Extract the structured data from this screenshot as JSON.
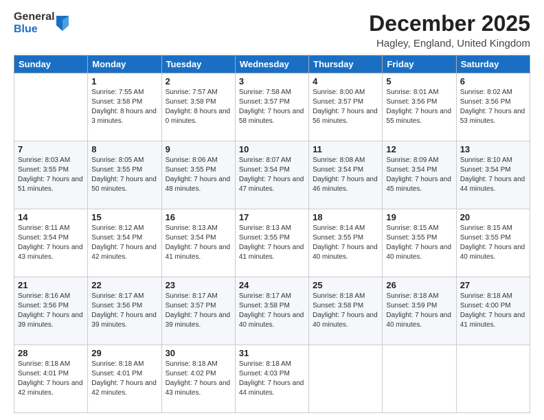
{
  "header": {
    "logo": {
      "general": "General",
      "blue": "Blue"
    },
    "title": "December 2025",
    "subtitle": "Hagley, England, United Kingdom"
  },
  "days_of_week": [
    "Sunday",
    "Monday",
    "Tuesday",
    "Wednesday",
    "Thursday",
    "Friday",
    "Saturday"
  ],
  "weeks": [
    [
      {
        "day": "",
        "sunrise": "",
        "sunset": "",
        "daylight": "",
        "empty": true
      },
      {
        "day": "1",
        "sunrise": "7:55 AM",
        "sunset": "3:58 PM",
        "daylight": "8 hours and 3 minutes.",
        "empty": false
      },
      {
        "day": "2",
        "sunrise": "7:57 AM",
        "sunset": "3:58 PM",
        "daylight": "8 hours and 0 minutes.",
        "empty": false
      },
      {
        "day": "3",
        "sunrise": "7:58 AM",
        "sunset": "3:57 PM",
        "daylight": "7 hours and 58 minutes.",
        "empty": false
      },
      {
        "day": "4",
        "sunrise": "8:00 AM",
        "sunset": "3:57 PM",
        "daylight": "7 hours and 56 minutes.",
        "empty": false
      },
      {
        "day": "5",
        "sunrise": "8:01 AM",
        "sunset": "3:56 PM",
        "daylight": "7 hours and 55 minutes.",
        "empty": false
      },
      {
        "day": "6",
        "sunrise": "8:02 AM",
        "sunset": "3:56 PM",
        "daylight": "7 hours and 53 minutes.",
        "empty": false
      }
    ],
    [
      {
        "day": "7",
        "sunrise": "8:03 AM",
        "sunset": "3:55 PM",
        "daylight": "7 hours and 51 minutes.",
        "empty": false
      },
      {
        "day": "8",
        "sunrise": "8:05 AM",
        "sunset": "3:55 PM",
        "daylight": "7 hours and 50 minutes.",
        "empty": false
      },
      {
        "day": "9",
        "sunrise": "8:06 AM",
        "sunset": "3:55 PM",
        "daylight": "7 hours and 48 minutes.",
        "empty": false
      },
      {
        "day": "10",
        "sunrise": "8:07 AM",
        "sunset": "3:54 PM",
        "daylight": "7 hours and 47 minutes.",
        "empty": false
      },
      {
        "day": "11",
        "sunrise": "8:08 AM",
        "sunset": "3:54 PM",
        "daylight": "7 hours and 46 minutes.",
        "empty": false
      },
      {
        "day": "12",
        "sunrise": "8:09 AM",
        "sunset": "3:54 PM",
        "daylight": "7 hours and 45 minutes.",
        "empty": false
      },
      {
        "day": "13",
        "sunrise": "8:10 AM",
        "sunset": "3:54 PM",
        "daylight": "7 hours and 44 minutes.",
        "empty": false
      }
    ],
    [
      {
        "day": "14",
        "sunrise": "8:11 AM",
        "sunset": "3:54 PM",
        "daylight": "7 hours and 43 minutes.",
        "empty": false
      },
      {
        "day": "15",
        "sunrise": "8:12 AM",
        "sunset": "3:54 PM",
        "daylight": "7 hours and 42 minutes.",
        "empty": false
      },
      {
        "day": "16",
        "sunrise": "8:13 AM",
        "sunset": "3:54 PM",
        "daylight": "7 hours and 41 minutes.",
        "empty": false
      },
      {
        "day": "17",
        "sunrise": "8:13 AM",
        "sunset": "3:55 PM",
        "daylight": "7 hours and 41 minutes.",
        "empty": false
      },
      {
        "day": "18",
        "sunrise": "8:14 AM",
        "sunset": "3:55 PM",
        "daylight": "7 hours and 40 minutes.",
        "empty": false
      },
      {
        "day": "19",
        "sunrise": "8:15 AM",
        "sunset": "3:55 PM",
        "daylight": "7 hours and 40 minutes.",
        "empty": false
      },
      {
        "day": "20",
        "sunrise": "8:15 AM",
        "sunset": "3:55 PM",
        "daylight": "7 hours and 40 minutes.",
        "empty": false
      }
    ],
    [
      {
        "day": "21",
        "sunrise": "8:16 AM",
        "sunset": "3:56 PM",
        "daylight": "7 hours and 39 minutes.",
        "empty": false
      },
      {
        "day": "22",
        "sunrise": "8:17 AM",
        "sunset": "3:56 PM",
        "daylight": "7 hours and 39 minutes.",
        "empty": false
      },
      {
        "day": "23",
        "sunrise": "8:17 AM",
        "sunset": "3:57 PM",
        "daylight": "7 hours and 39 minutes.",
        "empty": false
      },
      {
        "day": "24",
        "sunrise": "8:17 AM",
        "sunset": "3:58 PM",
        "daylight": "7 hours and 40 minutes.",
        "empty": false
      },
      {
        "day": "25",
        "sunrise": "8:18 AM",
        "sunset": "3:58 PM",
        "daylight": "7 hours and 40 minutes.",
        "empty": false
      },
      {
        "day": "26",
        "sunrise": "8:18 AM",
        "sunset": "3:59 PM",
        "daylight": "7 hours and 40 minutes.",
        "empty": false
      },
      {
        "day": "27",
        "sunrise": "8:18 AM",
        "sunset": "4:00 PM",
        "daylight": "7 hours and 41 minutes.",
        "empty": false
      }
    ],
    [
      {
        "day": "28",
        "sunrise": "8:18 AM",
        "sunset": "4:01 PM",
        "daylight": "7 hours and 42 minutes.",
        "empty": false
      },
      {
        "day": "29",
        "sunrise": "8:18 AM",
        "sunset": "4:01 PM",
        "daylight": "7 hours and 42 minutes.",
        "empty": false
      },
      {
        "day": "30",
        "sunrise": "8:18 AM",
        "sunset": "4:02 PM",
        "daylight": "7 hours and 43 minutes.",
        "empty": false
      },
      {
        "day": "31",
        "sunrise": "8:18 AM",
        "sunset": "4:03 PM",
        "daylight": "7 hours and 44 minutes.",
        "empty": false
      },
      {
        "day": "",
        "sunrise": "",
        "sunset": "",
        "daylight": "",
        "empty": true
      },
      {
        "day": "",
        "sunrise": "",
        "sunset": "",
        "daylight": "",
        "empty": true
      },
      {
        "day": "",
        "sunrise": "",
        "sunset": "",
        "daylight": "",
        "empty": true
      }
    ]
  ]
}
